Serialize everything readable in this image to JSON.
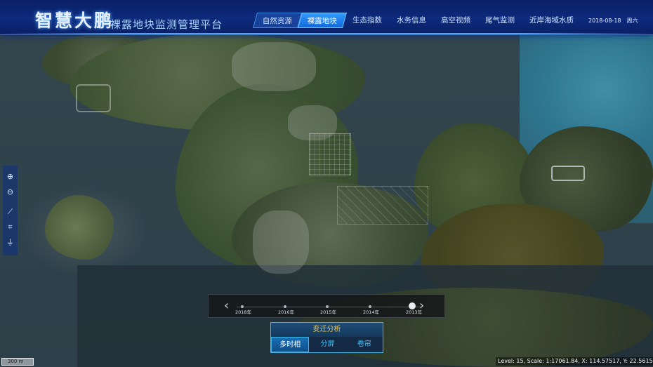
{
  "app": {
    "title": "智慧大鹏",
    "subtitle": "裸露地块监测管理平台"
  },
  "nav": {
    "items": [
      {
        "label": "自然资源",
        "state": "highlight"
      },
      {
        "label": "裸露地块",
        "state": "active"
      },
      {
        "label": "生态指数",
        "state": "normal"
      },
      {
        "label": "水务信息",
        "state": "normal"
      },
      {
        "label": "高空视频",
        "state": "normal"
      },
      {
        "label": "尾气监测",
        "state": "normal"
      },
      {
        "label": "近岸海域水质",
        "state": "normal"
      }
    ]
  },
  "datetime": {
    "date": "2018-08-18",
    "weekday": "周六"
  },
  "toolbar": {
    "tools": [
      {
        "name": "zoom-in-icon",
        "glyph": "⊕"
      },
      {
        "name": "zoom-out-icon",
        "glyph": "⊖"
      },
      {
        "name": "measure-ruler-icon",
        "glyph": "⟋"
      },
      {
        "name": "area-select-icon",
        "glyph": "⌗"
      },
      {
        "name": "locate-icon",
        "glyph": "⏚"
      }
    ]
  },
  "timeline": {
    "prev_glyph": "‹",
    "next_glyph": "›",
    "years": [
      "2018年",
      "2016年",
      "2015年",
      "2014年",
      "2013年"
    ],
    "selected": "2013年"
  },
  "panel": {
    "title": "变迁分析",
    "tabs": [
      {
        "label": "多时相",
        "active": true
      },
      {
        "label": "分屏",
        "active": false
      },
      {
        "label": "卷帘",
        "active": false
      }
    ]
  },
  "scale_bar": "300 m",
  "status_bar": "Level: 15, Scale: 1:17061.84, X: 114.57517, Y: 22.56158",
  "colors": {
    "header_bg": "#0d2a7c",
    "nav_active": "#1e88f0",
    "panel_title": "#f5c84a",
    "panel_tab_text": "#3fc6ff"
  }
}
